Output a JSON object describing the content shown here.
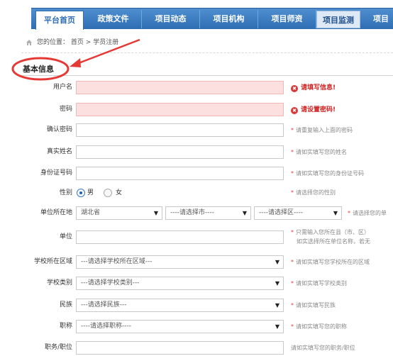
{
  "nav": {
    "items": [
      "平台首页",
      "政策文件",
      "项目动态",
      "项目机构",
      "项目师资",
      "项目监测",
      "项目"
    ],
    "active_index": 0,
    "colors": {
      "bar": "#2f6db3",
      "active_text": "#2f6db3"
    }
  },
  "breadcrumb": {
    "prefix": "您的位置：",
    "home": "首页",
    "separator": ">",
    "current": "学员注册"
  },
  "section": {
    "title": "基本信息"
  },
  "form": {
    "username": {
      "label": "用户名",
      "value": "",
      "error": "请填写信息!"
    },
    "password": {
      "label": "密码",
      "value": "",
      "error": "请设置密码!"
    },
    "confirm_password": {
      "label": "确认密码",
      "value": "",
      "hint": "请重复输入上面的密码"
    },
    "real_name": {
      "label": "真实姓名",
      "value": "",
      "hint": "请如实填写您的姓名"
    },
    "id_number": {
      "label": "身份证号码",
      "value": "",
      "hint": "请如实填写您的身份证号码"
    },
    "gender": {
      "label": "性别",
      "options": [
        "男",
        "女"
      ],
      "selected": "男",
      "hint": "请选择您的性别"
    },
    "work_location": {
      "label": "单位所在地",
      "province": "湖北省",
      "city": "----请选择市----",
      "district": "----请选择区----",
      "hint": "请选择您的单"
    },
    "unit": {
      "label": "单位",
      "value": "",
      "hint_line1": "只需输入您所在县（市、区）",
      "hint_line2": "如实选择所在单位名称，若无"
    },
    "school_area": {
      "label": "学校所在区域",
      "selected": "---请选择学校所在区域---",
      "hint": "请如实填写您学校所在的区域"
    },
    "school_type": {
      "label": "学校类别",
      "selected": "---请选择学校类别---",
      "hint": "请如实填写学校类别"
    },
    "ethnicity": {
      "label": "民族",
      "selected": "---请选择民族---",
      "hint": "请如实填写民族"
    },
    "title": {
      "label": "职称",
      "selected": "----请选择职称----",
      "hint": "请如实填写您的职称"
    },
    "position": {
      "label": "职务/职位",
      "value": "",
      "hint": "请如实填写您的职务/职位"
    }
  },
  "icons": {
    "home": "home-icon",
    "error": "error-icon",
    "dropdown": "chevron-down-icon"
  },
  "annotation_color": "#e53935"
}
